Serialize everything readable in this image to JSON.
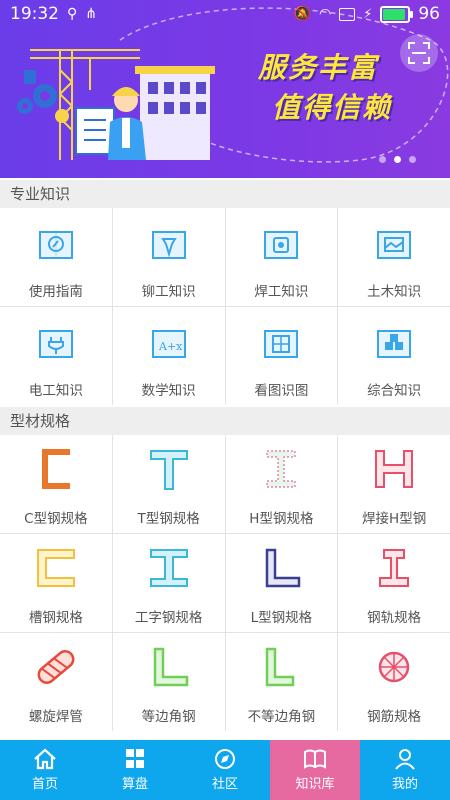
{
  "status_bar": {
    "time": "19:32",
    "battery": "96"
  },
  "banner": {
    "slogan_line1": "服务丰富",
    "slogan_line2": "值得信赖",
    "dots": 3,
    "active_dot": 1
  },
  "knowledge": {
    "title": "专业知识",
    "items": [
      {
        "label": "使用指南",
        "icon": "compass-book-icon"
      },
      {
        "label": "铆工知识",
        "icon": "rivet-book-icon"
      },
      {
        "label": "焊工知识",
        "icon": "welding-book-icon"
      },
      {
        "label": "土木知识",
        "icon": "civil-book-icon"
      },
      {
        "label": "电工知识",
        "icon": "plug-book-icon"
      },
      {
        "label": "数学知识",
        "icon": "formula-book-icon"
      },
      {
        "label": "看图识图",
        "icon": "drawing-book-icon"
      },
      {
        "label": "综合知识",
        "icon": "cubes-book-icon"
      }
    ]
  },
  "profiles": {
    "title": "型材规格",
    "items": [
      {
        "label": "C型钢规格",
        "icon": "c-steel-icon"
      },
      {
        "label": "T型钢规格",
        "icon": "t-steel-icon"
      },
      {
        "label": "H型钢规格",
        "icon": "h-steel-icon"
      },
      {
        "label": "焊接H型钢",
        "icon": "welded-h-steel-icon"
      },
      {
        "label": "槽钢规格",
        "icon": "channel-steel-icon"
      },
      {
        "label": "工字钢规格",
        "icon": "i-beam-icon"
      },
      {
        "label": "L型钢规格",
        "icon": "l-steel-icon"
      },
      {
        "label": "钢轨规格",
        "icon": "rail-icon"
      },
      {
        "label": "螺旋焊管",
        "icon": "spiral-pipe-icon"
      },
      {
        "label": "等边角钢",
        "icon": "equal-angle-icon"
      },
      {
        "label": "不等边角钢",
        "icon": "unequal-angle-icon"
      },
      {
        "label": "钢筋规格",
        "icon": "rebar-icon"
      }
    ]
  },
  "tabbar": {
    "items": [
      {
        "label": "首页",
        "icon": "home-icon"
      },
      {
        "label": "算盘",
        "icon": "grid-icon"
      },
      {
        "label": "社区",
        "icon": "compass-icon"
      },
      {
        "label": "知识库",
        "icon": "book-icon"
      },
      {
        "label": "我的",
        "icon": "person-icon"
      }
    ],
    "active_index": 3
  },
  "colors": {
    "banner": "#7b39e6",
    "slogan": "#ffe63a",
    "tabbar": "#0ea7ee",
    "tab_active": "#e66aa0",
    "icon_blue": "#39a6e8"
  }
}
